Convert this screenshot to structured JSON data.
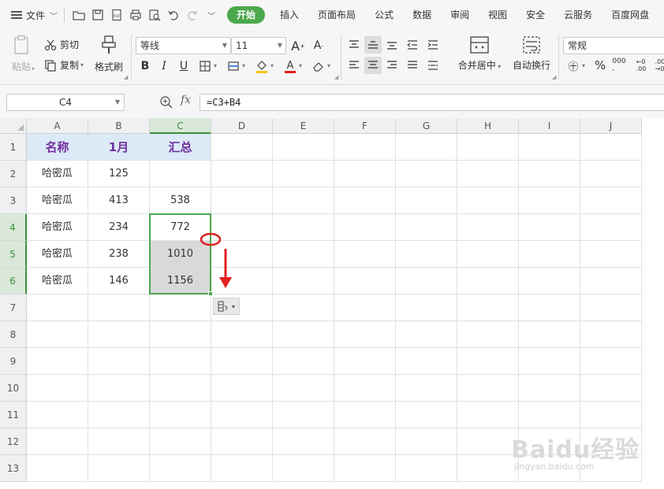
{
  "menubar": {
    "file_label": "文件",
    "tabs": [
      {
        "label": "开始",
        "active": true
      },
      {
        "label": "插入"
      },
      {
        "label": "页面布局"
      },
      {
        "label": "公式"
      },
      {
        "label": "数据"
      },
      {
        "label": "审阅"
      },
      {
        "label": "视图"
      },
      {
        "label": "安全"
      },
      {
        "label": "云服务"
      },
      {
        "label": "百度网盘"
      }
    ]
  },
  "ribbon": {
    "paste_label": "粘贴",
    "cut_label": "剪切",
    "copy_label": "复制",
    "format_painter_label": "格式刷",
    "font_name": "等线",
    "font_size": "11",
    "merge_center_label": "合并居中",
    "wrap_text_label": "自动换行",
    "number_format": "常规",
    "bold": "B",
    "italic": "I",
    "underline": "U",
    "percent": "%"
  },
  "formula_bar": {
    "cell_ref": "C4",
    "fx": "fx",
    "formula": "=C3+B4"
  },
  "grid": {
    "columns": [
      "A",
      "B",
      "C",
      "D",
      "E",
      "F",
      "G",
      "H",
      "I",
      "J"
    ],
    "rows": [
      "1",
      "2",
      "3",
      "4",
      "5",
      "6",
      "7",
      "8",
      "9",
      "10",
      "11",
      "12",
      "13"
    ],
    "header_row": [
      "名称",
      "1月",
      "汇总"
    ],
    "data_rows": [
      [
        "哈密瓜",
        "125",
        ""
      ],
      [
        "哈密瓜",
        "413",
        "538"
      ],
      [
        "哈密瓜",
        "234",
        "772"
      ],
      [
        "哈密瓜",
        "238",
        "1010"
      ],
      [
        "哈密瓜",
        "146",
        "1156"
      ]
    ],
    "selected_cell": "C4",
    "selected_range": "C4:C6"
  },
  "colors": {
    "accent_green": "#4ca84c",
    "header_fill": "#dce9f6",
    "header_text": "#7030a0",
    "annotation_red": "#e02020"
  },
  "watermark": {
    "main": "Baidu经验",
    "sub": "jingyan.baidu.com"
  }
}
